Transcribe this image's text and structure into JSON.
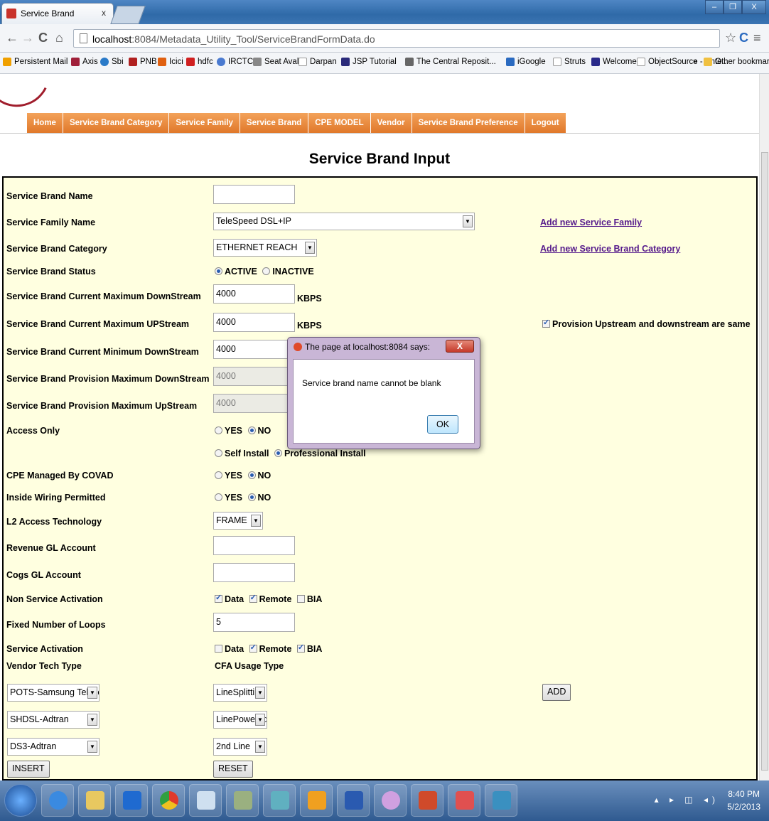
{
  "browser": {
    "tab_title": "Service Brand",
    "tab_close": "x",
    "url_host": "localhost",
    "url_rest": ":8084/Metadata_Utility_Tool/ServiceBrandFormData.do",
    "bookmarks": [
      "Persistent Mail",
      "Axis",
      "Sbi",
      "PNB",
      "Icici",
      "hdfc",
      "IRCTC",
      "Seat Aval",
      "Darpan",
      "JSP Tutorial",
      "The Central Reposit...",
      "iGoogle",
      "Struts",
      "Welcome",
      "ObjectSource - Ente..."
    ],
    "bookmarks_more": "»",
    "other_bookmarks": "Other bookmarks"
  },
  "menu": [
    "Home",
    "Service Brand Category",
    "Service Family",
    "Service Brand",
    "CPE MODEL",
    "Vendor",
    "Service Brand Preference",
    "Logout"
  ],
  "page_title": "Service Brand Input",
  "form": {
    "service_brand_name": {
      "label": "Service Brand Name",
      "value": ""
    },
    "service_family_name": {
      "label": "Service Family Name",
      "value": "TeleSpeed DSL+IP",
      "link": "Add new Service Family"
    },
    "service_brand_category": {
      "label": "Service Brand Category",
      "value": "ETHERNET REACH",
      "link": "Add new Service Brand Category"
    },
    "service_brand_status": {
      "label": "Service Brand Status",
      "opt1": "ACTIVE",
      "opt2": "INACTIVE",
      "selected": "ACTIVE"
    },
    "cur_max_down": {
      "label": "Service Brand Current Maximum DownStream",
      "value": "4000",
      "unit": "KBPS"
    },
    "cur_max_up": {
      "label": "Service Brand Current Maximum UPStream",
      "value": "4000",
      "unit": "KBPS",
      "checkbox_label": "Provision Upstream and downstream are same",
      "checked": true
    },
    "cur_min_down": {
      "label": "Service Brand Current Minimum DownStream",
      "value": "4000"
    },
    "prov_max_down": {
      "label": "Service Brand Provision Maximum DownStream",
      "value": "4000"
    },
    "prov_max_up": {
      "label": "Service Brand Provision Maximum UpStream",
      "value": "4000"
    },
    "access_only": {
      "label": "Access Only",
      "opt1": "YES",
      "opt2": "NO",
      "selected": "NO"
    },
    "install": {
      "opt1": "Self Install",
      "opt2": "Professional Install",
      "selected": "Professional Install"
    },
    "cpe_managed": {
      "label": "CPE Managed By COVAD",
      "opt1": "YES",
      "opt2": "NO",
      "selected": "NO"
    },
    "inside_wiring": {
      "label": "Inside Wiring Permitted",
      "opt1": "YES",
      "opt2": "NO",
      "selected": "NO"
    },
    "l2_access": {
      "label": "L2 Access Technology",
      "value": "FRAME"
    },
    "revenue_gl": {
      "label": "Revenue GL Account",
      "value": ""
    },
    "cogs_gl": {
      "label": "Cogs GL Account",
      "value": ""
    },
    "non_service_activation": {
      "label": "Non Service Activation",
      "data": "Data",
      "remote": "Remote",
      "bia": "BIA"
    },
    "fixed_loops": {
      "label": "Fixed Number of Loops",
      "value": "5"
    },
    "service_activation": {
      "label": "Service Activation",
      "data": "Data",
      "remote": "Remote",
      "bia": "BIA"
    },
    "vendor_tech_type": {
      "label": "Vendor Tech Type",
      "values": [
        "POTS-Samsung Telecom",
        "SHDSL-Adtran",
        "DS3-Adtran"
      ]
    },
    "cfa_usage_type": {
      "label": "CFA Usage Type",
      "values": [
        "LineSplitting",
        "LinePowered",
        "2nd Line"
      ]
    },
    "add_button": "ADD",
    "insert_button": "INSERT",
    "reset_button": "RESET"
  },
  "dialog": {
    "title": "The page at localhost:8084 says:",
    "close": "X",
    "message": "Service brand name cannot be blank",
    "ok": "OK"
  },
  "taskbar": {
    "time": "8:40 PM",
    "date": "5/2/2013",
    "tray": "▴ ▸ ◫ ◂)"
  },
  "colors": {
    "menu_orange": "#e6893a",
    "form_bg": "#ffffe0",
    "link": "#551a8b"
  }
}
